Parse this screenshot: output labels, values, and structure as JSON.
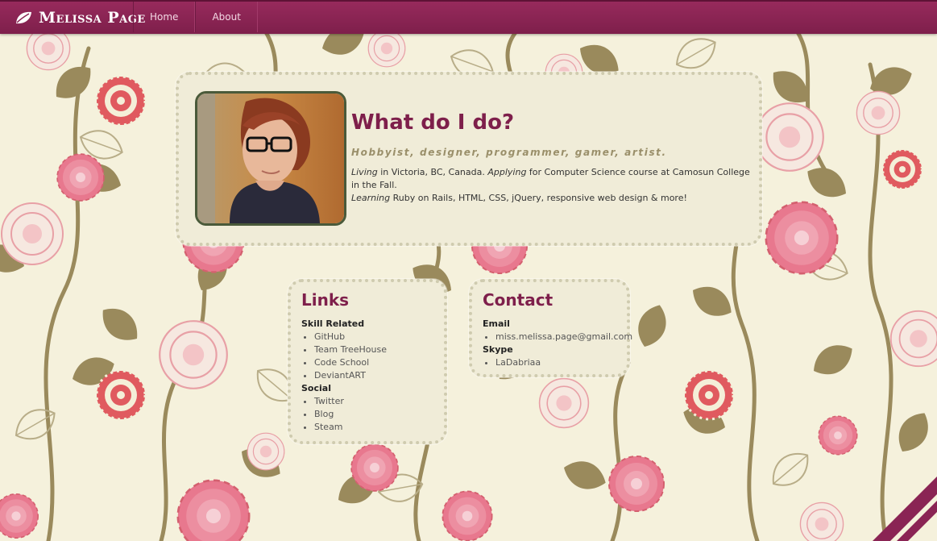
{
  "brand": {
    "name": "Melissa Page",
    "icon": "leaf-icon"
  },
  "nav": {
    "items": [
      {
        "label": "Home"
      },
      {
        "label": "About"
      }
    ]
  },
  "hero": {
    "title": "What do I do?",
    "tagline": "Hobbyist, designer, programmer, gamer, artist.",
    "bio": [
      {
        "em": "Living",
        "text": " in Victoria, BC, Canada. "
      },
      {
        "em": "Applying",
        "text": " for Computer Science course at Camosun College in the Fall."
      },
      {
        "em": "Learning",
        "text": " Ruby on Rails, HTML, CSS, jQuery, responsive web design & more!"
      }
    ]
  },
  "links": {
    "title": "Links",
    "groups": [
      {
        "label": "Skill Related",
        "items": [
          "GitHub",
          "Team TreeHouse",
          "Code School",
          "DeviantART"
        ]
      },
      {
        "label": "Social",
        "items": [
          "Twitter",
          "Blog",
          "Steam"
        ]
      }
    ]
  },
  "contact": {
    "title": "Contact",
    "groups": [
      {
        "label": "Email",
        "items": [
          "miss.melissa.page@gmail.com"
        ]
      },
      {
        "label": "Skype",
        "items": [
          "LaDabriaa"
        ]
      }
    ]
  },
  "colors": {
    "accent": "#7e1f4b",
    "navbar": "#8a2454",
    "background": "#f5f1dc",
    "card": "#f0ecd8",
    "tagline": "#9a8f6a"
  }
}
